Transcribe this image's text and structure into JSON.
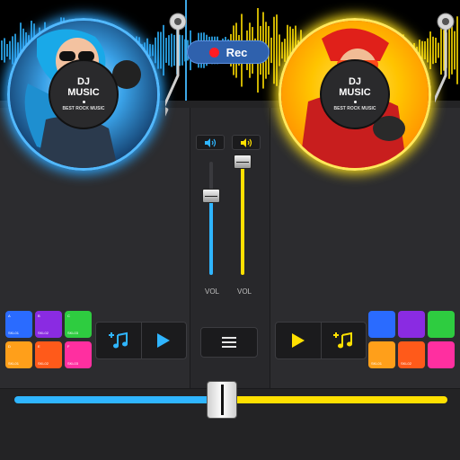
{
  "waveform": {
    "left_color": "#2fb5ff",
    "right_color": "#ffe000",
    "playhead_color": "#3da7e6"
  },
  "record": {
    "label": "Rec",
    "dot_color": "#ff1c24"
  },
  "deck_left": {
    "accent": "#2fb5ff",
    "disc_title_line1": "DJ",
    "disc_title_line2": "MUSIC",
    "disc_subtitle": "BEST ROCK MUSIC",
    "pads": [
      {
        "color": "#2a6bff",
        "label": "A",
        "sub": "SKL01"
      },
      {
        "color": "#8a2be2",
        "label": "B",
        "sub": "SKL02"
      },
      {
        "color": "#2ecc40",
        "label": "C",
        "sub": "SKL03"
      },
      {
        "color": "#ff9f1a",
        "label": "D",
        "sub": "SKL01"
      },
      {
        "color": "#ff5a1a",
        "label": "E",
        "sub": "SKL02"
      },
      {
        "color": "#ff2fa0",
        "label": "F",
        "sub": "SKL03"
      }
    ],
    "buttons": [
      "music-note-add-icon",
      "play-icon"
    ]
  },
  "deck_right": {
    "accent": "#ffe000",
    "disc_title_line1": "DJ",
    "disc_title_line2": "MUSIC",
    "disc_subtitle": "BEST ROCK MUSIC",
    "pads": [
      {
        "color": "#2a6bff",
        "label": "",
        "sub": ""
      },
      {
        "color": "#8a2be2",
        "label": "",
        "sub": ""
      },
      {
        "color": "#2ecc40",
        "label": "",
        "sub": ""
      },
      {
        "color": "#ff9f1a",
        "label": "",
        "sub": "SKL01"
      },
      {
        "color": "#ff5a1a",
        "label": "",
        "sub": "SKL02"
      },
      {
        "color": "#ff2fa0",
        "label": "",
        "sub": ""
      }
    ],
    "buttons": [
      "play-icon",
      "music-note-add-icon"
    ]
  },
  "mixer": {
    "vol_left_label": "VOL",
    "vol_right_label": "VOL",
    "vol_left_level": 0.7,
    "vol_right_level": 1.0
  },
  "crossfader": {
    "position": 0.48
  }
}
